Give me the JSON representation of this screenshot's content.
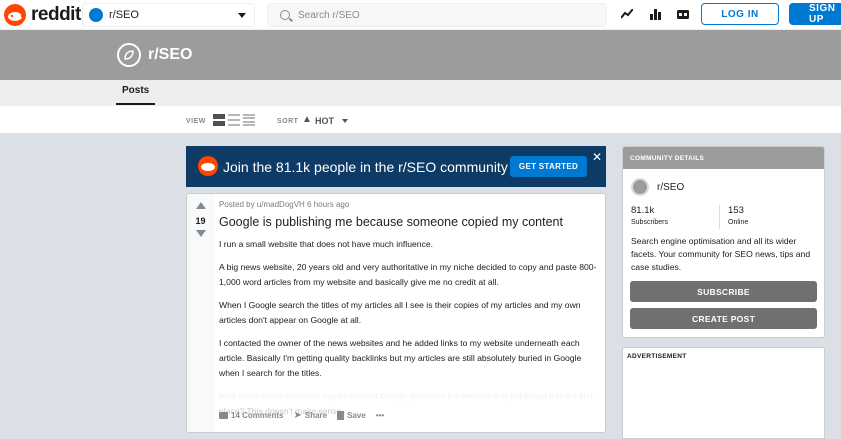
{
  "header": {
    "logo_text": "reddit",
    "community": "r/SEO",
    "search_placeholder": "Search r/SEO",
    "login_label": "LOG IN",
    "signup_label": "SIGN UP"
  },
  "banner": {
    "title": "r/SEO"
  },
  "tabs": {
    "posts": "Posts"
  },
  "viewbar": {
    "view_label": "VIEW",
    "sort_label": "SORT",
    "sort_value": "HOT"
  },
  "join_banner": {
    "text": "Join the 81.1k people in the r/SEO community",
    "button": "GET STARTED",
    "close": "✕"
  },
  "post": {
    "votes": "19",
    "meta": "Posted by u/madDogVH 6 hours ago",
    "title": "Google is publishing me because someone copied my content",
    "paragraphs": [
      "I run a small website that does not have much influence.",
      "A big news website, 20 years old and very authoritative in my niche decided to copy and paste 800-1,000 word articles from my website and basically give me no credit at all.",
      "When I Google search the titles of my articles all I see is their copies of my articles and my own articles don't appear on Google at all.",
      "I contacted the owner of the news websites and he added links to my website underneath each article. Basically I'm getting quality backlinks but my articles are still absolutely buried in Google when I search for the titles.",
      "How come when someone copies content Google punishes the website that published it in the first place? This doesn't make sense."
    ],
    "comments": "14 Comments",
    "share": "Share",
    "save": "Save",
    "more": "•••"
  },
  "sidebar": {
    "heading": "COMMUNITY DETAILS",
    "name": "r/SEO",
    "subscribers_value": "81.1k",
    "subscribers_label": "Subscribers",
    "online_value": "153",
    "online_label": "Online",
    "description": "Search engine optimisation and all its wider facets. Your community for SEO news, tips and case studies.",
    "subscribe": "SUBSCRIBE",
    "create_post": "CREATE POST",
    "ad_label": "ADVERTISEMENT"
  },
  "colors": {
    "accent": "#0079d3",
    "brand": "#ff4500",
    "banner": "#9c9c9c"
  }
}
